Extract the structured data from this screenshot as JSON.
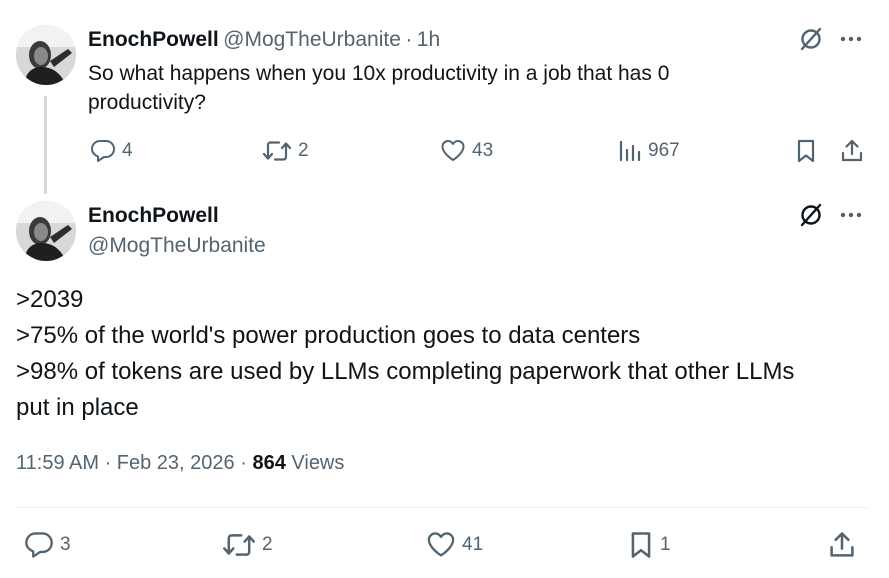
{
  "reply_parent": {
    "author_name": "EnochPowell",
    "author_handle": "@MogTheUrbanite",
    "separator": "·",
    "time": "1h",
    "text": "So what happens when you 10x productivity in a job that has 0 productivity?",
    "actions": {
      "replies": "4",
      "reposts": "2",
      "likes": "43",
      "views": "967"
    }
  },
  "main_post": {
    "author_name": "EnochPowell",
    "author_handle": "@MogTheUrbanite",
    "lines": [
      ">2039",
      ">75% of the world's power production goes to data centers",
      ">98% of tokens are used by LLMs completing paperwork that other LLMs",
      "put in place"
    ],
    "timestamp": "11:59 AM · Feb 23, 2026 ·",
    "view_count": "864",
    "views_label": "Views",
    "actions": {
      "replies": "3",
      "reposts": "2",
      "likes": "41",
      "bookmarks": "1"
    }
  },
  "icons": {
    "grok": "grok-icon",
    "more": "more-icon",
    "reply": "reply-icon",
    "repost": "repost-icon",
    "like": "like-icon",
    "views": "views-icon",
    "bookmark": "bookmark-icon",
    "share": "share-icon"
  },
  "colors": {
    "text": "#0f1419",
    "secondary": "#536471",
    "thread_line": "#cfd9de",
    "divider": "#eff3f4"
  }
}
